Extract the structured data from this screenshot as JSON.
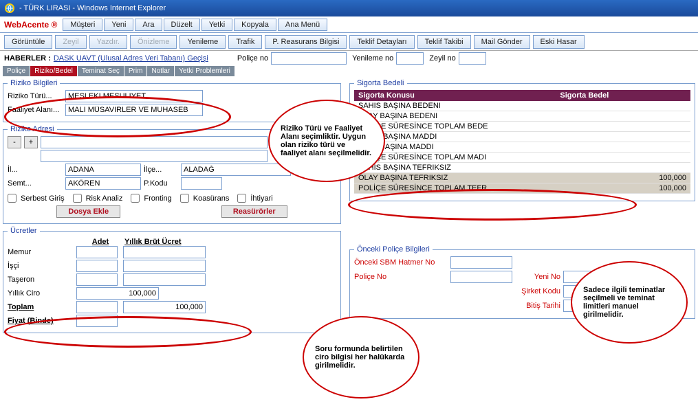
{
  "title": "- TÜRK LIRASI - Windows Internet Explorer",
  "brand": "WebAcente ®",
  "menu1": {
    "musteri": "Müşteri",
    "yeni": "Yeni",
    "ara": "Ara",
    "duzelt": "Düzelt",
    "yetki": "Yetki",
    "kopyala": "Kopyala",
    "anamenu": "Ana Menü"
  },
  "menu2": {
    "goruntule": "Görüntüle",
    "zeyil": "Zeyil",
    "yazdir": "Yazdır.",
    "onizleme": "Önizleme",
    "yenileme": "Yenileme",
    "trafik": "Trafik",
    "reasurans": "P. Reasurans Bilgisi",
    "teklifd": "Teklif Detayları",
    "teklift": "Teklif Takibi",
    "mail": "Mail Gönder",
    "eski": "Eski Hasar"
  },
  "top": {
    "haberler": "HABERLER :",
    "link": "DASK UAVT (Ulusal Adres Veri Tabanı) Geçişi",
    "police_no": "Poliçe no",
    "yenileme_no": "Yenileme no",
    "zeyil_no": "Zeyil no"
  },
  "subtabs": {
    "police": "Poliçe",
    "riziko": "Riziko/Bedel",
    "teminat": "Teminat Seç",
    "prim": "Prim",
    "notlar": "Notlar",
    "yetki": "Yetki Problemleri"
  },
  "riziko_bilgileri": {
    "legend": "Riziko Bilgileri",
    "turu_lbl": "Riziko Türü...",
    "turu_val": "MESLEKI MESULIYET",
    "faaliyet_lbl": "Faaliyet Alanı...",
    "faaliyet_val": "MALI MÜSAVIRLER VE MUHASEB"
  },
  "riziko_adresi": {
    "legend": "Riziko Adresi",
    "il_lbl": "İl...",
    "il_val": "ADANA",
    "ilce_lbl": "İlçe...",
    "ilce_val": "ALADAĞ",
    "semt_lbl": "Semt...",
    "semt_val": "AKÖREN",
    "pkodu_lbl": "P.Kodu",
    "serbest": "Serbest Giriş",
    "risk": "Risk Analiz",
    "fronting": "Fronting",
    "koasurans": "Koasürans",
    "ihtiyari": "İhtiyari",
    "dosya": "Dosya Ekle",
    "reasur": "Reasürörler"
  },
  "sigorta": {
    "legend": "Sigorta Bedeli",
    "th1": "Sigorta Konusu",
    "th2": "Sigorta Bedel",
    "rows": [
      {
        "konu": "SAHIS BAŞINA BEDENI",
        "bedel": ""
      },
      {
        "konu": "OLAY BAŞINA BEDENI",
        "bedel": ""
      },
      {
        "konu": "POLİÇE SÜRESİNCE TOPLAM BEDE",
        "bedel": ""
      },
      {
        "konu": "SAHIS BAŞINA MADDI",
        "bedel": ""
      },
      {
        "konu": "OLAY BAŞINA MADDI",
        "bedel": ""
      },
      {
        "konu": "POLİÇE SÜRESİNCE TOPLAM MADI",
        "bedel": ""
      },
      {
        "konu": "SAHIS BAŞINA TEFRIKSIZ",
        "bedel": ""
      },
      {
        "konu": "OLAY BAŞINA TEFRIKSIZ",
        "bedel": "100,000"
      },
      {
        "konu": "POLİÇE SÜRESİNCE TOPLAM TEFR",
        "bedel": "100,000"
      }
    ]
  },
  "ucretler": {
    "legend": "Ücretler",
    "adet": "Adet",
    "yillik": "Yıllık Brüt Ücret",
    "memur": "Memur",
    "isci": "İşçi",
    "taseron": "Taşeron",
    "ciro_lbl": "Yıllık Ciro",
    "ciro_val": "100,000",
    "toplam_lbl": "Toplam",
    "toplam_val": "100,000",
    "fiyat": "Fiyat (Binde)"
  },
  "onceki": {
    "legend": "Önceki Poliçe Bilgileri",
    "sbm": "Önceki SBM Hatmer No",
    "police": "Poliçe No",
    "yeni": "Yeni No",
    "sirket": "Şirket Kodu",
    "bitis": "Bitiş Tarihi"
  },
  "annotations": {
    "a1": "Riziko Türü ve Faaliyet Alanı seçimliktir. Uygun olan riziko türü ve faaliyet alanı seçilmelidir.",
    "a2": "Soru formunda belirtilen ciro bilgisi her halükarda girilmelidir.",
    "a3": "Sadece ilgili teminatlar seçilmeli ve teminat limitleri manuel girilmelidir."
  }
}
